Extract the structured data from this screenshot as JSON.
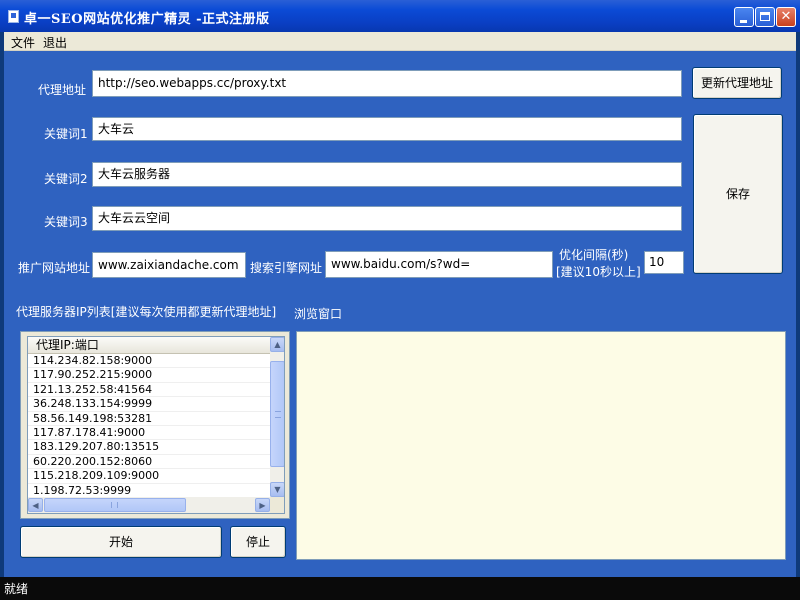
{
  "window": {
    "title": "卓一SEO网站优化推广精灵 -正式注册版"
  },
  "menu": {
    "file": "文件",
    "exit": "退出"
  },
  "form": {
    "proxy_address_label": "代理地址",
    "proxy_address_value": "http://seo.webapps.cc/proxy.txt",
    "update_proxy_button": "更新代理地址",
    "keyword1_label": "关键词1",
    "keyword1_value": "大车云",
    "keyword2_label": "关键词2",
    "keyword2_value": "大车云服务器",
    "keyword3_label": "关键词3",
    "keyword3_value": "大车云云空间",
    "save_button": "保存",
    "promo_site_label": "推广网站地址",
    "promo_site_value": "www.zaixiandache.com",
    "search_engine_label": "搜索引擎网址",
    "search_engine_value": "www.baidu.com/s?wd=",
    "interval_label_line1": "优化间隔(秒)",
    "interval_label_line2": "[建议10秒以上]",
    "interval_value": "10"
  },
  "proxy_list": {
    "title": "代理服务器IP列表[建议每次使用都更新代理地址]",
    "column_header": "代理IP:端口",
    "items": [
      "114.234.82.158:9000",
      "117.90.252.215:9000",
      "121.13.252.58:41564",
      "36.248.133.154:9999",
      "58.56.149.198:53281",
      "117.87.178.41:9000",
      "183.129.207.80:13515",
      "60.220.200.152:8060",
      "115.218.209.109:9000",
      "1.198.72.53:9999"
    ]
  },
  "browser": {
    "title": "浏览窗口"
  },
  "controls": {
    "start_button": "开始",
    "stop_button": "停止"
  },
  "status": {
    "text": "就绪"
  },
  "colors": {
    "title_bar": "#0a3fc4",
    "client_background": "#2f62c0",
    "browser_background": "#fdfce6",
    "status_bar": "#0a0a0a"
  }
}
